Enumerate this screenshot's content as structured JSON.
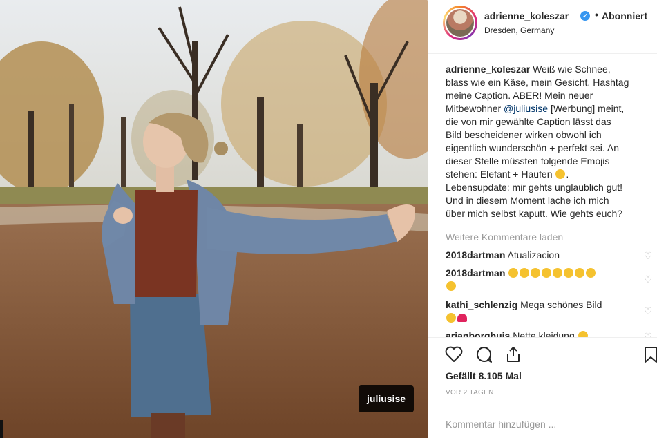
{
  "header": {
    "username": "adrienne_koleszar",
    "separator": "•",
    "follow_state": "Abonniert",
    "location": "Dresden, Germany"
  },
  "photo": {
    "tag_label": "juliusise"
  },
  "caption": {
    "username": "adrienne_koleszar",
    "line1": "Weiß wie Schnee,",
    "line2": "blass wie ein Käse, mein Gesicht. Hashtag",
    "line3": "meine Caption. ABER! Mein neuer",
    "line4_pre": "Mitbewohner ",
    "mention": "@juliusise",
    "line4_post": " [Werbung] meint,",
    "line5": "die von mir gewählte Caption lässt das",
    "line6": "Bild bescheidener wirken obwohl ich",
    "line7": "eigentlich wunderschön + perfekt sei. An",
    "line8": "dieser Stelle müssten folgende Emojis",
    "line9": "stehen: Elefant + Haufen",
    "line9_end": ".",
    "line10": "Lebensupdate: mir gehts unglaublich gut!",
    "line11": "Und in diesem Moment lache ich mich",
    "line12": "über mich selbst kaputt. Wie gehts euch?"
  },
  "load_more": "Weitere Kommentare laden",
  "comments": [
    {
      "user": "2018dartman",
      "text": "Atualizacion"
    },
    {
      "user": "2018dartman",
      "text": ""
    },
    {
      "user": "kathi_schlenzig",
      "text": "Mega schönes Bild"
    },
    {
      "user": "arjanborghuis",
      "text": "Nette kleidung"
    }
  ],
  "actions": {
    "likes_label": "Gefällt",
    "likes_count": "8.105 Mal",
    "timestamp": "VOR 2 TAGEN"
  },
  "add_comment": {
    "placeholder": "Kommentar hinzufügen ..."
  },
  "icons": {
    "verified": "verified-badge-icon",
    "like": "heart-icon",
    "comment": "comment-bubble-icon",
    "share": "share-icon",
    "save": "bookmark-icon",
    "comment_like": "small-heart-icon"
  },
  "colors": {
    "verified_blue": "#3897f0",
    "text": "#262626",
    "muted": "#999999",
    "mention": "#003569"
  }
}
